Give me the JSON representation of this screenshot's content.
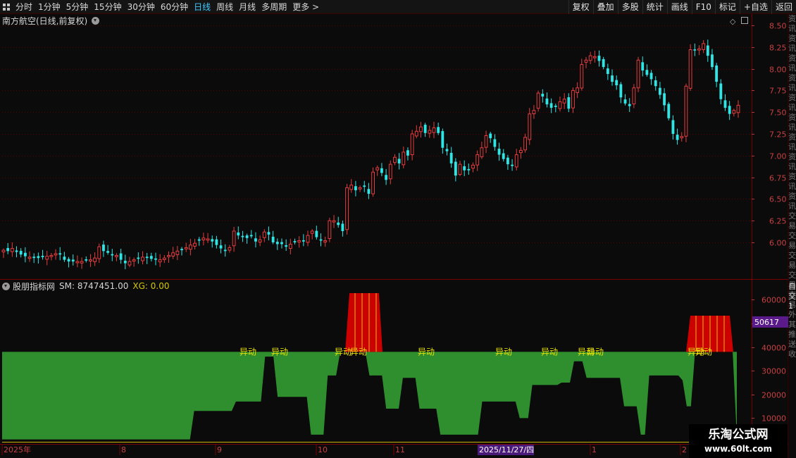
{
  "toolbar": {
    "periods": [
      "分时",
      "1分钟",
      "5分钟",
      "15分钟",
      "30分钟",
      "60分钟",
      "日线",
      "周线",
      "月线",
      "多周期",
      "更多 >"
    ],
    "active_period": "日线",
    "tools": [
      "复权",
      "叠加",
      "多股",
      "统计",
      "画线",
      "F10",
      "标记",
      "+自选",
      "返回"
    ]
  },
  "main_chart": {
    "title": "南方航空(日线,前复权)",
    "price_axis": [
      "8.50",
      "8.25",
      "8.00",
      "7.75",
      "7.50",
      "7.25",
      "7.00",
      "6.75",
      "6.50",
      "6.25",
      "6.00"
    ],
    "up_color": "#e83c3c",
    "down_color": "#2ee6e6"
  },
  "indicator": {
    "name": "股朋指标网",
    "sm": "SM: 8747451.00",
    "xg": "XG: 0.00",
    "axis": [
      "60000",
      "50000",
      "40000",
      "30000",
      "20000",
      "10000"
    ],
    "current_value": "50617",
    "signal_label": "异动",
    "fill_color": "#2f8f2f",
    "alert_color": "#cc0000"
  },
  "date_axis": {
    "labels": [
      "2025年",
      "8",
      "9",
      "10",
      "11",
      "1",
      "2"
    ],
    "cursor_date": "2025/11/27/四"
  },
  "right_strip_text": "资讯资讯资讯资讯资讯资讯资讯资讯资讯资讯交易交易交易交易交易外其推送收",
  "sub_strip_text": "自交1",
  "watermark": {
    "title": "乐淘公式网",
    "url": "www.60lt.com"
  },
  "chart_data": [
    {
      "type": "candlestick",
      "title": "南方航空(日线,前复权)",
      "ylim": [
        5.7,
        8.55
      ],
      "y_ticks": [
        8.5,
        8.25,
        8.0,
        7.75,
        7.5,
        7.25,
        7.0,
        6.75,
        6.5,
        6.25,
        6.0
      ],
      "x_ticks": [
        "2025年",
        "8",
        "9",
        "10",
        "11",
        "1",
        "2"
      ],
      "grid": true,
      "close": [
        5.91,
        5.9,
        5.93,
        5.89,
        5.86,
        5.84,
        5.83,
        5.82,
        5.82,
        5.83,
        5.84,
        5.85,
        5.87,
        5.86,
        5.8,
        5.78,
        5.78,
        5.78,
        5.78,
        5.79,
        5.8,
        5.82,
        5.95,
        5.9,
        5.88,
        5.85,
        5.85,
        5.8,
        5.76,
        5.78,
        5.8,
        5.81,
        5.83,
        5.82,
        5.81,
        5.8,
        5.8,
        5.82,
        5.85,
        5.88,
        5.9,
        5.91,
        5.94,
        5.97,
        5.99,
        6.02,
        6.05,
        6.04,
        6.01,
        5.97,
        5.93,
        5.9,
        5.94,
        6.13,
        6.08,
        6.06,
        6.05,
        6.07,
        6.01,
        6.03,
        6.12,
        6.09,
        6.0,
        5.98,
        5.98,
        5.95,
        5.98,
        6.0,
        6.02,
        6.01,
        6.08,
        6.13,
        6.06,
        6.02,
        6.02,
        6.25,
        6.25,
        6.2,
        6.13,
        6.63,
        6.66,
        6.6,
        6.63,
        6.64,
        6.56,
        6.81,
        6.86,
        6.8,
        6.72,
        6.9,
        6.98,
        6.91,
        7.04,
        7.0,
        7.25,
        7.28,
        7.33,
        7.26,
        7.29,
        7.32,
        7.26,
        7.09,
        7.05,
        6.91,
        6.77,
        6.9,
        6.83,
        6.83,
        6.89,
        7.01,
        7.09,
        7.23,
        7.2,
        7.1,
        7.01,
        6.96,
        6.9,
        6.88,
        7.01,
        7.06,
        7.21,
        7.48,
        7.52,
        7.72,
        7.68,
        7.59,
        7.55,
        7.56,
        7.62,
        7.65,
        7.54,
        7.75,
        7.78,
        8.05,
        8.1,
        8.15,
        8.14,
        8.09,
        8.02,
        7.94,
        7.85,
        7.81,
        7.67,
        7.6,
        7.57,
        7.78,
        8.1,
        7.98,
        7.93,
        7.88,
        7.8,
        7.7,
        7.58,
        7.43,
        7.25,
        7.18,
        7.22,
        7.8,
        8.22,
        8.21,
        8.23,
        8.29,
        8.15,
        8.02,
        7.85,
        7.65,
        7.55,
        7.48,
        7.52,
        7.58
      ]
    },
    {
      "type": "area",
      "title": "股朋指标网",
      "ylim": [
        0,
        65000
      ],
      "y_ticks": [
        60000,
        50000,
        40000,
        30000,
        20000,
        10000
      ],
      "annotations": [
        "SM: 8747451.00",
        "XG: 0.00",
        "50617",
        "异动"
      ],
      "series": [
        {
          "name": "SM",
          "values": [
            1000,
            1000,
            1000,
            1000,
            1000,
            1000,
            1000,
            1000,
            1000,
            1000,
            1000,
            1000,
            1000,
            1000,
            1000,
            1000,
            1000,
            1000,
            1000,
            1000,
            1000,
            1000,
            1000,
            1000,
            1000,
            1000,
            1000,
            1000,
            1000,
            1000,
            1000,
            1000,
            1000,
            1000,
            1000,
            1000,
            1000,
            1000,
            1000,
            1000,
            1000,
            1000,
            1000,
            1000,
            1000,
            1000,
            13000,
            13000,
            13000,
            13000,
            13000,
            13000,
            13000,
            13000,
            13000,
            13000,
            17000,
            17000,
            17000,
            17000,
            17000,
            17000,
            17000,
            36000,
            36000,
            36000,
            19000,
            19000,
            19000,
            19000,
            19000,
            19000,
            19000,
            19000,
            3000,
            3000,
            3000,
            3000,
            28000,
            28000,
            28000,
            38000,
            38000,
            38000,
            38000,
            38000,
            38000,
            38000,
            28000,
            28000,
            28000,
            28000,
            14000,
            14000,
            14000,
            14000,
            27000,
            27000,
            27000,
            27000,
            14000,
            14000,
            14000,
            14000,
            14000,
            3000,
            3000,
            3000,
            3000,
            3000,
            3000,
            3000,
            3000,
            3000,
            3000,
            17000,
            17000,
            17000,
            17000,
            17000,
            17000,
            17000,
            17000,
            17000,
            10000,
            10000,
            10000,
            24000,
            24000,
            24000,
            24000,
            24000,
            24000,
            24000,
            25000,
            25000,
            25000,
            34000,
            34000,
            34000,
            27000,
            27000,
            27000,
            27000,
            27000,
            27000,
            27000,
            27000,
            27000,
            15000,
            15000,
            15000,
            15000,
            3000,
            3000,
            28000,
            28000,
            28000,
            28000,
            28000,
            28000,
            28000,
            28000,
            26000,
            15000,
            15000,
            38000,
            38000,
            38000,
            38000,
            38000,
            38000,
            38000,
            38000,
            38000,
            38000,
            2000
          ]
        },
        {
          "name": "XG",
          "values": [
            0
          ]
        }
      ]
    }
  ]
}
